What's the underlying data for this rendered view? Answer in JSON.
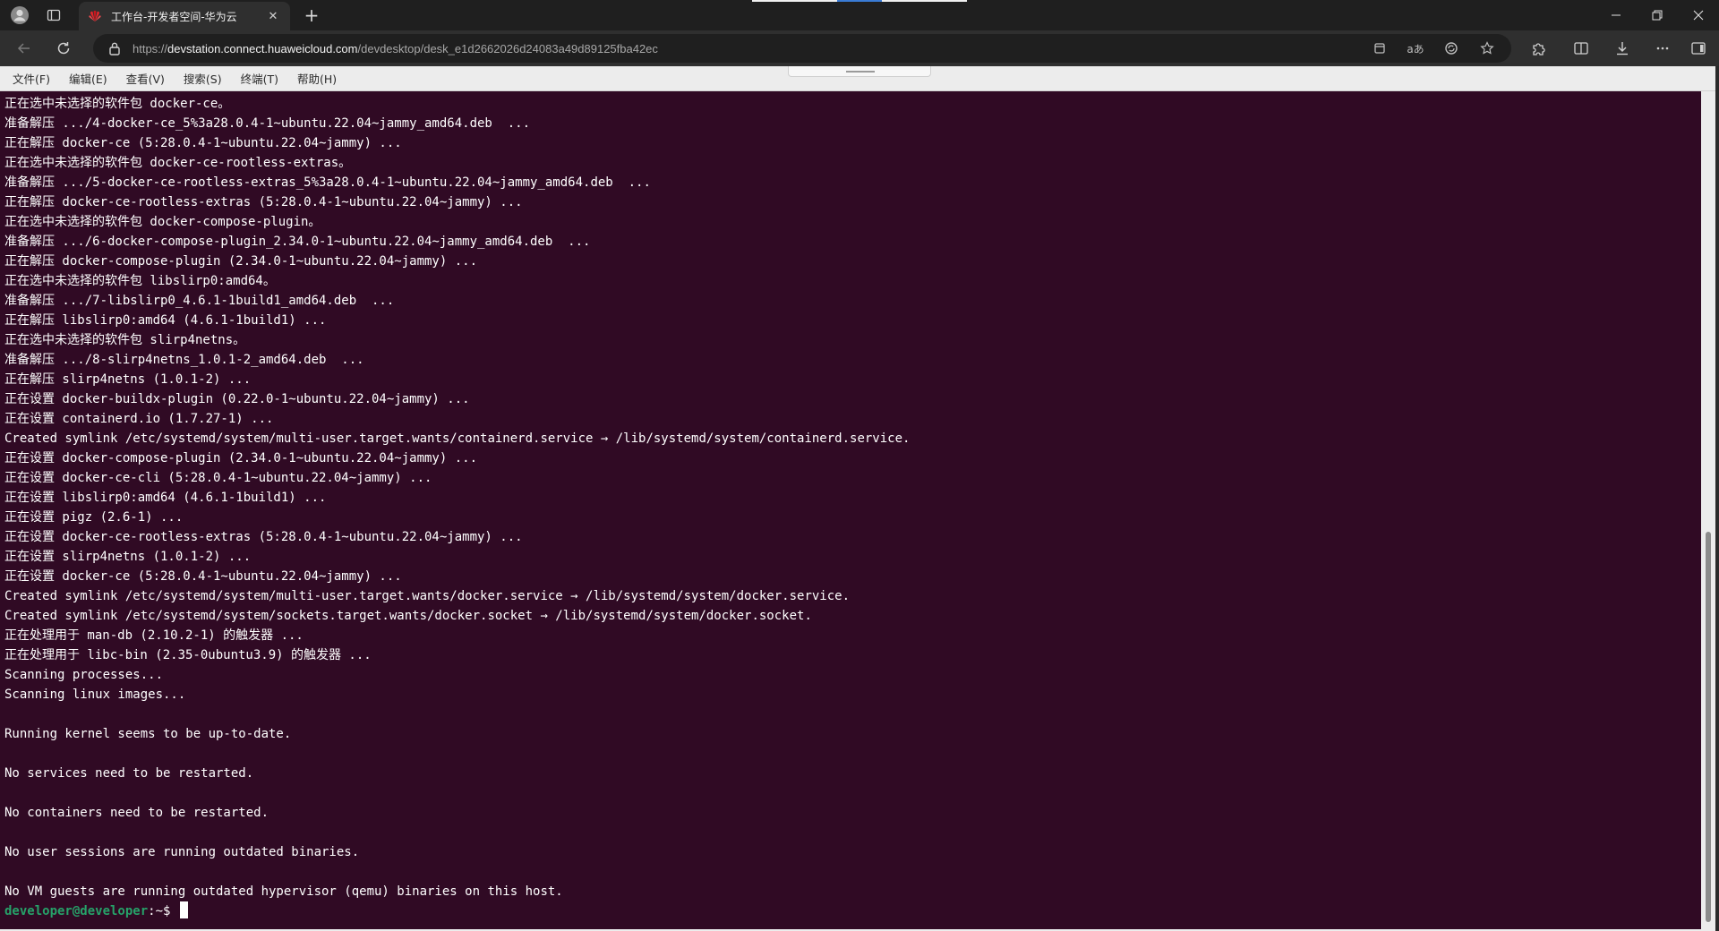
{
  "browser": {
    "tab_title": "工作台-开发者空间-华为云",
    "url_prefix": "https://",
    "url_host": "devstation.connect.huaweicloud.com",
    "url_path": "/devdesktop/desk_e1d2662026d24083a49d89125fba42ec",
    "icons": {
      "profile": "profile-icon",
      "tab_actions": "tab-actions-icon",
      "favicon": "huawei-cloud-logo",
      "tab_close": "close-icon",
      "new_tab": "plus-icon",
      "back": "back-arrow-icon",
      "reload": "reload-icon",
      "lock": "lock-icon",
      "app_install": "app-install-icon",
      "read_aloud": "read-aloud-icon",
      "refresh_sync": "sync-icon",
      "favorite": "star-icon",
      "extensions": "puzzle-icon",
      "split_screen": "split-screen-icon",
      "downloads": "download-icon",
      "more": "more-icon",
      "sidebar": "sidebar-icon",
      "minimize": "minimize-icon",
      "restore": "restore-icon",
      "close_window": "close-window-icon"
    },
    "read_aloud_label": "aあ"
  },
  "terminal": {
    "menu": [
      "文件(F)",
      "编辑(E)",
      "查看(V)",
      "搜索(S)",
      "终端(T)",
      "帮助(H)"
    ],
    "colors": {
      "background": "#300a24",
      "text": "#ffffff",
      "prompt_user": "#26a269"
    },
    "lines": [
      "正在选中未选择的软件包 docker-ce。",
      "准备解压 .../4-docker-ce_5%3a28.0.4-1~ubuntu.22.04~jammy_amd64.deb  ...",
      "正在解压 docker-ce (5:28.0.4-1~ubuntu.22.04~jammy) ...",
      "正在选中未选择的软件包 docker-ce-rootless-extras。",
      "准备解压 .../5-docker-ce-rootless-extras_5%3a28.0.4-1~ubuntu.22.04~jammy_amd64.deb  ...",
      "正在解压 docker-ce-rootless-extras (5:28.0.4-1~ubuntu.22.04~jammy) ...",
      "正在选中未选择的软件包 docker-compose-plugin。",
      "准备解压 .../6-docker-compose-plugin_2.34.0-1~ubuntu.22.04~jammy_amd64.deb  ...",
      "正在解压 docker-compose-plugin (2.34.0-1~ubuntu.22.04~jammy) ...",
      "正在选中未选择的软件包 libslirp0:amd64。",
      "准备解压 .../7-libslirp0_4.6.1-1build1_amd64.deb  ...",
      "正在解压 libslirp0:amd64 (4.6.1-1build1) ...",
      "正在选中未选择的软件包 slirp4netns。",
      "准备解压 .../8-slirp4netns_1.0.1-2_amd64.deb  ...",
      "正在解压 slirp4netns (1.0.1-2) ...",
      "正在设置 docker-buildx-plugin (0.22.0-1~ubuntu.22.04~jammy) ...",
      "正在设置 containerd.io (1.7.27-1) ...",
      "Created symlink /etc/systemd/system/multi-user.target.wants/containerd.service → /lib/systemd/system/containerd.service.",
      "正在设置 docker-compose-plugin (2.34.0-1~ubuntu.22.04~jammy) ...",
      "正在设置 docker-ce-cli (5:28.0.4-1~ubuntu.22.04~jammy) ...",
      "正在设置 libslirp0:amd64 (4.6.1-1build1) ...",
      "正在设置 pigz (2.6-1) ...",
      "正在设置 docker-ce-rootless-extras (5:28.0.4-1~ubuntu.22.04~jammy) ...",
      "正在设置 slirp4netns (1.0.1-2) ...",
      "正在设置 docker-ce (5:28.0.4-1~ubuntu.22.04~jammy) ...",
      "Created symlink /etc/systemd/system/multi-user.target.wants/docker.service → /lib/systemd/system/docker.service.",
      "Created symlink /etc/systemd/system/sockets.target.wants/docker.socket → /lib/systemd/system/docker.socket.",
      "正在处理用于 man-db (2.10.2-1) 的触发器 ...",
      "正在处理用于 libc-bin (2.35-0ubuntu3.9) 的触发器 ...",
      "Scanning processes...",
      "Scanning linux images...",
      "",
      "Running kernel seems to be up-to-date.",
      "",
      "No services need to be restarted.",
      "",
      "No containers need to be restarted.",
      "",
      "No user sessions are running outdated binaries.",
      "",
      "No VM guests are running outdated hypervisor (qemu) binaries on this host."
    ],
    "prompt": {
      "user_host": "developer@developer",
      "path": ":~",
      "symbol": "$ "
    }
  }
}
